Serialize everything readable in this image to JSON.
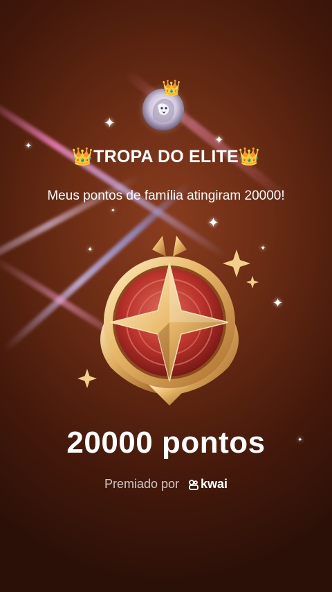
{
  "header": {
    "family_name": "👑TROPA DO ELITE👑",
    "message": "Meus pontos de família atingiram 20000!"
  },
  "avatar": {
    "icon": "lion-crown-icon",
    "crown": "👑"
  },
  "badge": {
    "icon": "star-medal-icon",
    "colors": {
      "gold": "#e8b96a",
      "gold_dark": "#a86a2a",
      "red": "#b8322a",
      "red_light": "#e06a5a"
    }
  },
  "reward": {
    "points_label": "20000 pontos",
    "awarded_by": "Premiado por",
    "brand": "kwai"
  },
  "theme": {
    "background": "#6a2c14",
    "text": "#ffffff"
  }
}
